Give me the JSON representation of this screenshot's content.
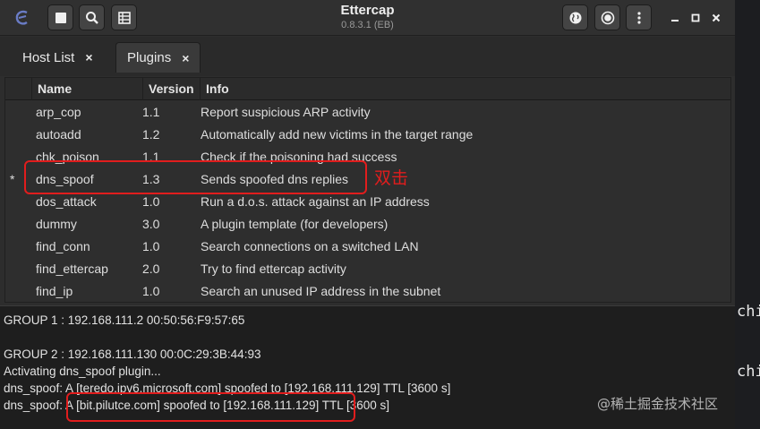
{
  "window": {
    "title": "Ettercap",
    "subtitle": "0.8.3.1 (EB)"
  },
  "toolbar": {
    "left_icons": [
      "ettercap-logo-icon",
      "stop-icon",
      "search-icon",
      "hosts-grid-icon"
    ],
    "right_icons": [
      "globe-icon",
      "record-icon",
      "kebab-menu-icon"
    ],
    "window_controls": [
      "minimize-icon",
      "maximize-icon",
      "close-icon"
    ]
  },
  "tabs": [
    {
      "label": "Host List",
      "close": "×",
      "active": false
    },
    {
      "label": "Plugins",
      "close": "×",
      "active": true
    }
  ],
  "plugins_table": {
    "columns": [
      "Name",
      "Version",
      "Info"
    ],
    "rows": [
      {
        "mark": "",
        "name": "arp_cop",
        "version": "1.1",
        "info": "Report suspicious ARP activity"
      },
      {
        "mark": "",
        "name": "autoadd",
        "version": "1.2",
        "info": "Automatically add new victims in the target range"
      },
      {
        "mark": "",
        "name": "chk_poison",
        "version": "1.1",
        "info": "Check if the poisoning had success"
      },
      {
        "mark": "*",
        "name": "dns_spoof",
        "version": "1.3",
        "info": "Sends spoofed dns replies"
      },
      {
        "mark": "",
        "name": "dos_attack",
        "version": "1.0",
        "info": "Run a d.o.s. attack against an IP address"
      },
      {
        "mark": "",
        "name": "dummy",
        "version": "3.0",
        "info": "A plugin template (for developers)"
      },
      {
        "mark": "",
        "name": "find_conn",
        "version": "1.0",
        "info": "Search connections on a switched LAN"
      },
      {
        "mark": "",
        "name": "find_ettercap",
        "version": "2.0",
        "info": "Try to find ettercap activity"
      },
      {
        "mark": "",
        "name": "find_ip",
        "version": "1.0",
        "info": "Search an unused IP address in the subnet"
      }
    ]
  },
  "log": {
    "lines": [
      "GROUP 1 : 192.168.111.2 00:50:56:F9:57:65",
      "",
      "GROUP 2 : 192.168.111.130 00:0C:29:3B:44:93",
      "Activating dns_spoof plugin...",
      "dns_spoof: A [teredo.ipv6.microsoft.com] spoofed to [192.168.111.129] TTL [3600 s]",
      "dns_spoof: A [bit.pilutce.com] spoofed to [192.168.111.129] TTL [3600 s]"
    ]
  },
  "annotation": {
    "text": "双击",
    "color": "#e11d1d"
  },
  "background_terminal": {
    "lines": [
      "chi",
      "chi"
    ]
  },
  "watermark": "@稀土掘金技术社区"
}
